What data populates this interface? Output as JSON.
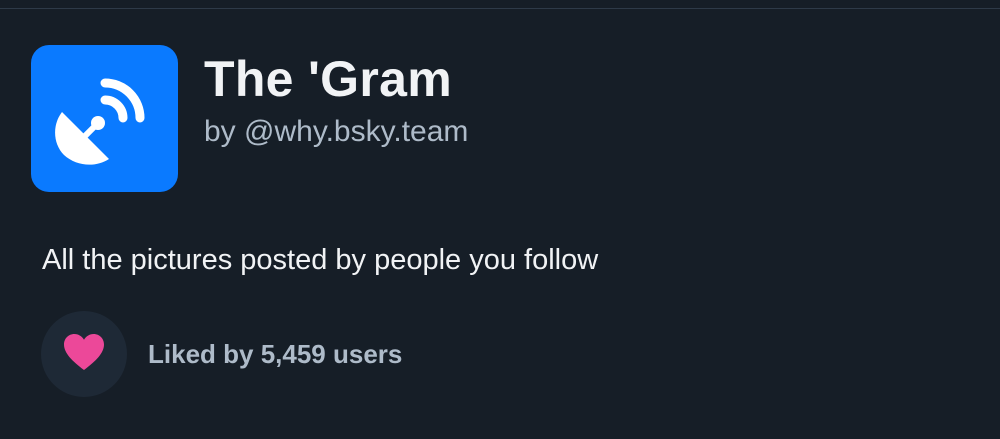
{
  "feed": {
    "title": "The 'Gram",
    "author": "by @why.bsky.team",
    "description": "All the pictures posted by people you follow",
    "avatar_icon": "satellite-dish-icon",
    "avatar_color": "#0a7aff"
  },
  "likes": {
    "label": "Liked by 5,459 users",
    "icon": "heart-icon",
    "heart_color": "#ec4899"
  },
  "colors": {
    "background": "#161e27",
    "text_primary": "#f1f3f5",
    "text_secondary": "#aebbc9"
  }
}
